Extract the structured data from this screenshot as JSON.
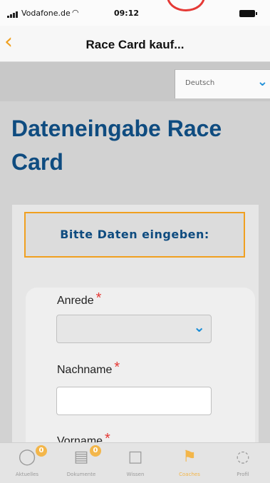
{
  "status_bar": {
    "carrier": "Vodafone.de",
    "time": "09:12"
  },
  "nav": {
    "back_symbol": "‹",
    "title": "Race Card kauf..."
  },
  "language": {
    "selected": "Deutsch",
    "chevron_icon": "chevron-down-icon"
  },
  "page": {
    "title": "Dateneingabe Race Card"
  },
  "form": {
    "banner": "Bitte Daten eingeben:",
    "required_mark": "*",
    "fields": [
      {
        "label": "Anrede",
        "type": "select",
        "value": ""
      },
      {
        "label": "Nachname",
        "type": "text",
        "value": ""
      },
      {
        "label": "Vorname",
        "type": "text",
        "value": ""
      }
    ]
  },
  "tabs": [
    {
      "label": "Aktuelles",
      "icon": "speech-bubble-icon",
      "badge": "0"
    },
    {
      "label": "Dokumente",
      "icon": "document-icon",
      "badge": "0"
    },
    {
      "label": "Wissen",
      "icon": "book-icon",
      "badge": ""
    },
    {
      "label": "Coaches",
      "icon": "flag-icon",
      "badge": ""
    },
    {
      "label": "Profil",
      "icon": "chat-icon",
      "badge": ""
    }
  ],
  "colors": {
    "accent": "#f0a020",
    "title_blue": "#0f4c80",
    "chevron_blue": "#1b8ed8",
    "required_red": "#e53935"
  }
}
